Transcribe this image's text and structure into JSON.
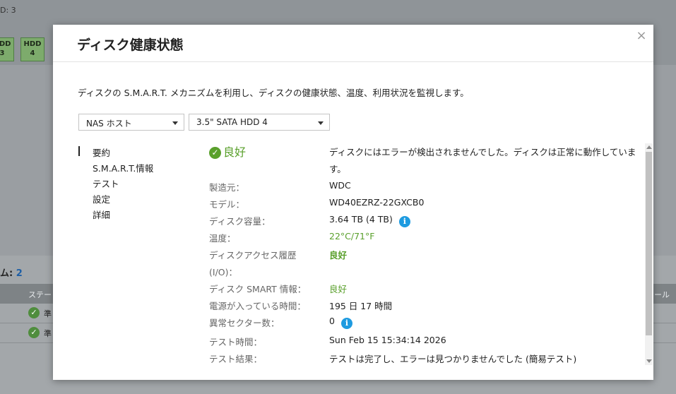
{
  "background": {
    "top_text": "D: 3",
    "hdd_tiles": [
      {
        "line1": "HDD",
        "line2": "3"
      },
      {
        "line1": "HDD",
        "line2": "4"
      }
    ],
    "section_label": "ム:",
    "section_count": "2",
    "table_headers": [
      "ステー",
      "ール"
    ],
    "rows": [
      {
        "text": "準"
      },
      {
        "text": "準"
      }
    ]
  },
  "modal": {
    "title": "ディスク健康状態",
    "description": "ディスクの S.M.A.R.T. メカニズムを利用し、ディスクの健康状態、温度、利用状況を監視します。",
    "host_select": {
      "value": "NAS ホスト"
    },
    "disk_select": {
      "value": "3.5\" SATA HDD 4"
    },
    "nav": [
      "要約",
      "S.M.A.R.T.情報",
      "テスト",
      "設定",
      "詳細"
    ],
    "summary": {
      "status": "良好",
      "status_message_line1": "ディスクにはエラーが検出されませんでした。ディスクは正常に動作していま",
      "status_message_line2": "す。",
      "fields": {
        "manufacturer": {
          "label": "製造元：",
          "value": "WDC"
        },
        "model": {
          "label": "モデル：",
          "value": "WD40EZRZ-22GXCB0"
        },
        "capacity": {
          "label": "ディスク容量：",
          "value": "3.64 TB (4 TB)"
        },
        "temperature": {
          "label": "温度：",
          "value": "22°C/71°F"
        },
        "access_history": {
          "label_line1": "ディスクアクセス履歴",
          "label_line2": "(I/O)：",
          "value": "良好"
        },
        "smart_info": {
          "label": "ディスク SMART 情報：",
          "value": "良好"
        },
        "power_on_time": {
          "label": "電源が入っている時間：",
          "value": "195 日 17 時間"
        },
        "bad_sectors": {
          "label": "異常セクター数：",
          "value": "0"
        },
        "test_time": {
          "label": "テスト時間：",
          "value": "Sun Feb 15 15:34:14 2026"
        },
        "test_result": {
          "label": "テスト結果：",
          "value": "テストは完了し、エラーは見つかりませんでした (簡易テスト)"
        }
      }
    }
  },
  "colors": {
    "ok_green": "#5aa02c",
    "info_blue": "#1e9be0"
  },
  "icons": {
    "status": "check-circle-icon",
    "info": "info-icon",
    "close": "close-icon"
  }
}
